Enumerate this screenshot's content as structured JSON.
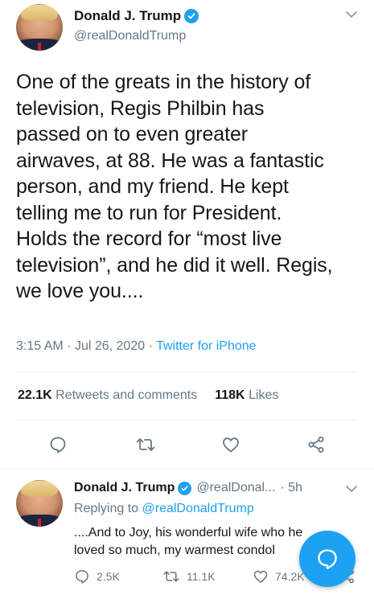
{
  "main_tweet": {
    "author": {
      "display_name": "Donald J. Trump",
      "handle": "@realDonaldTrump",
      "verified": true
    },
    "text": "One of the greats in the history of\ntelevision, Regis Philbin has\npassed on to even greater\nairwaves, at 88. He was a fantastic\nperson, and my friend. He kept\ntelling me to run for President.\nHolds the record for “most live\ntelevision”, and he did it well. Regis,\nwe love you....",
    "time": "3:15 AM",
    "date": "Jul 26, 2020",
    "source": "Twitter for iPhone",
    "stats": {
      "retweets_count": "22.1K",
      "retweets_label": "Retweets and comments",
      "likes_count": "118K",
      "likes_label": "Likes"
    },
    "icons": [
      "reply-icon",
      "retweet-icon",
      "like-icon",
      "share-icon"
    ]
  },
  "reply_tweet": {
    "author": {
      "display_name": "Donald J. Trump",
      "handle": "@realDonal...",
      "verified": true
    },
    "time_ago": "· 5h",
    "replying_prefix": "Replying to",
    "replying_to": "@realDonaldTrump",
    "text": "....And to Joy, his wonderful wife who he\nloved so much, my warmest condol",
    "actions": {
      "comments": "2.5K",
      "retweets": "11.1K",
      "likes": "74.2K"
    }
  },
  "colors": {
    "accent": "#1da1f2",
    "text": "#14171a",
    "secondary": "#657786",
    "divider": "#e6ecf0"
  }
}
